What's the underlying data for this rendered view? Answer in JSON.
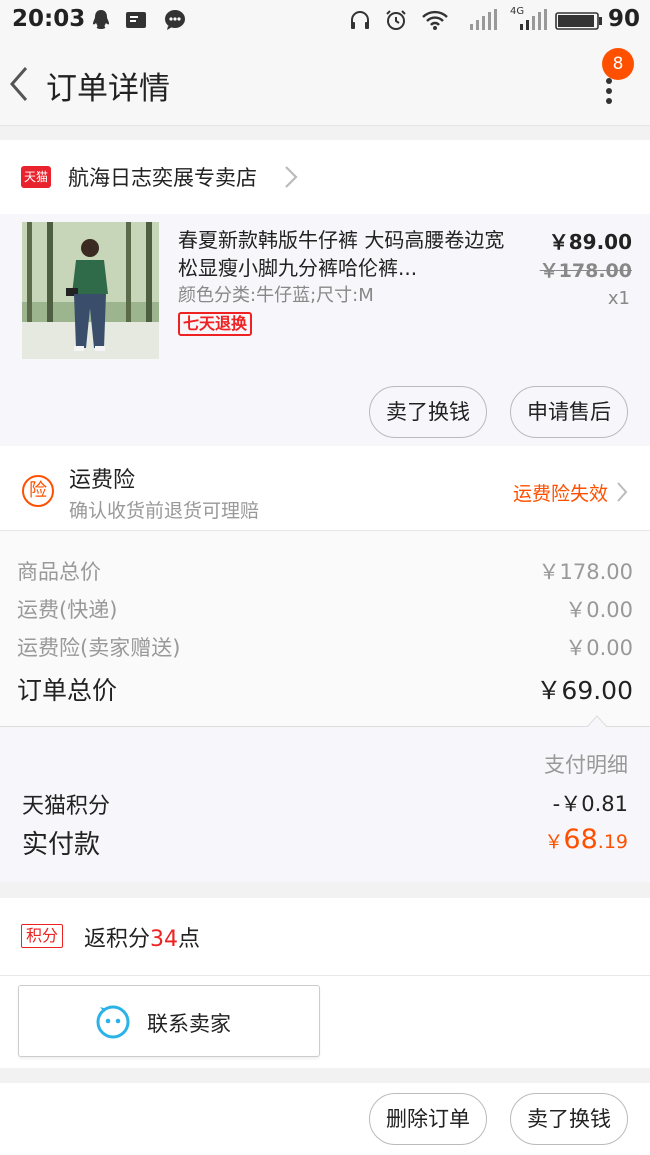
{
  "status_bar": {
    "time": "20:03",
    "battery": "90",
    "network": "4G"
  },
  "nav": {
    "title": "订单详情",
    "badge": "8"
  },
  "shop": {
    "logo_text": "天猫",
    "name": "航海日志奕展专卖店"
  },
  "product": {
    "title": "春夏新款韩版牛仔裤 大码高腰卷边宽松显瘦小脚九分裤哈伦裤...",
    "sku": "颜色分类:牛仔蓝;尺寸:M",
    "tag": "七天退换",
    "price_now": "￥89.00",
    "price_old": "￥178.00",
    "quantity": "x1",
    "btn_sell": "卖了换钱",
    "btn_aftersale": "申请售后"
  },
  "insurance": {
    "icon_text": "险",
    "title": "运费险",
    "subtitle": "确认收货前退货可理赔",
    "status": "运费险失效"
  },
  "prices": {
    "rows": [
      {
        "label": "商品总价",
        "value": "￥178.00"
      },
      {
        "label": "运费(快递)",
        "value": "￥0.00"
      },
      {
        "label": "运费险(卖家赠送)",
        "value": "￥0.00"
      }
    ],
    "total_label": "订单总价",
    "total_value": "￥69.00"
  },
  "payment": {
    "header": "支付明细",
    "points_label": "天猫积分",
    "points_value": "-￥0.81",
    "paid_label": "实付款",
    "paid_currency": "￥",
    "paid_int": "68",
    "paid_dec": ".19"
  },
  "points": {
    "tag": "积分",
    "prefix": "返积分",
    "count": "34",
    "suffix": "点"
  },
  "contact": {
    "label": "联系卖家"
  },
  "bottom": {
    "delete_label": "删除订单",
    "sell_label": "卖了换钱"
  },
  "colors": {
    "accent": "#ff5000",
    "tmall_red": "#e8232d"
  }
}
